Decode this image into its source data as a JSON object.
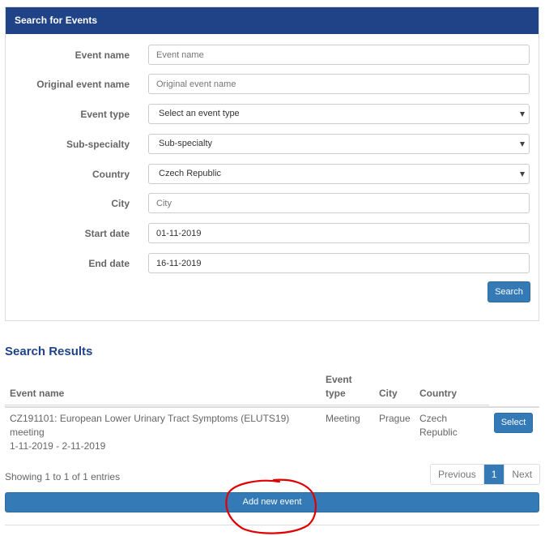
{
  "search_panel": {
    "title": "Search for Events",
    "fields": [
      {
        "label": "Event name",
        "type": "text",
        "value": "",
        "placeholder": "Event name"
      },
      {
        "label": "Original event name",
        "type": "text",
        "value": "",
        "placeholder": "Original event name"
      },
      {
        "label": "Event type",
        "type": "select",
        "value": "Select an event type"
      },
      {
        "label": "Sub-specialty",
        "type": "select",
        "value": "Sub-specialty"
      },
      {
        "label": "Country",
        "type": "select",
        "value": "Czech Republic"
      },
      {
        "label": "City",
        "type": "text",
        "value": "",
        "placeholder": "City"
      },
      {
        "label": "Start date",
        "type": "text",
        "value": "01-11-2019",
        "placeholder": ""
      },
      {
        "label": "End date",
        "type": "text",
        "value": "16-11-2019",
        "placeholder": ""
      }
    ],
    "search_label": "Search"
  },
  "results": {
    "title": "Search Results",
    "columns": {
      "event_name": "Event name",
      "event_type_line1": "Event",
      "event_type_line2": "type",
      "city": "City",
      "country": "Country"
    },
    "rows": [
      {
        "name_line1": "CZ191101: European Lower Urinary Tract Symptoms (ELUTS19)",
        "name_line2": "meeting",
        "dates": "1-11-2019 - 2-11-2019",
        "event_type": "Meeting",
        "city": "Prague",
        "country_line1": "Czech",
        "country_line2": "Republic",
        "select_label": "Select"
      }
    ],
    "showing_text": "Showing 1 to 1 of 1 entries",
    "pagination": {
      "previous": "Previous",
      "current": "1",
      "next": "Next"
    },
    "add_new_label": "Add new event"
  },
  "colors": {
    "header_blue": "#1f4386",
    "button_blue": "#337ab7",
    "annotation_red": "#e00000"
  }
}
